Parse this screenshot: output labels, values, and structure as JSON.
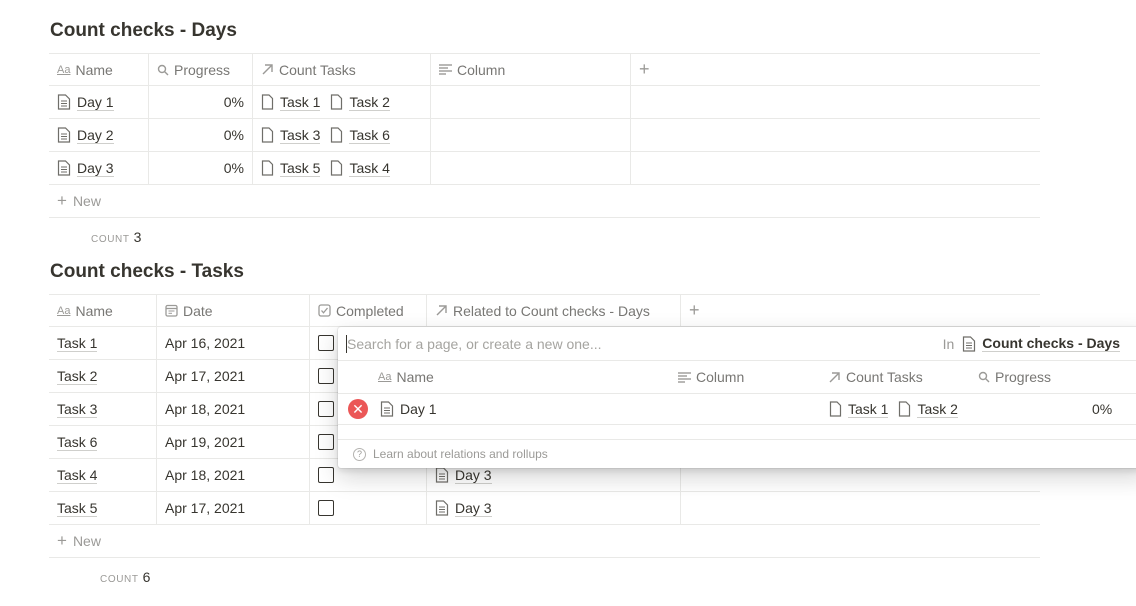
{
  "days_db": {
    "title": "Count checks - Days",
    "columns": {
      "name": "Name",
      "progress": "Progress",
      "count_tasks": "Count Tasks",
      "column": "Column"
    },
    "rows": [
      {
        "name": "Day 1",
        "progress": "0%",
        "task_a": "Task 1",
        "task_b": "Task 2"
      },
      {
        "name": "Day 2",
        "progress": "0%",
        "task_a": "Task 3",
        "task_b": "Task 6"
      },
      {
        "name": "Day 3",
        "progress": "0%",
        "task_a": "Task 5",
        "task_b": "Task 4"
      }
    ],
    "new_label": "New",
    "count_label": "COUNT",
    "count_value": "3"
  },
  "tasks_db": {
    "title": "Count checks - Tasks",
    "columns": {
      "name": "Name",
      "date": "Date",
      "completed": "Completed",
      "related": "Related to Count checks - Days"
    },
    "rows": [
      {
        "name": "Task 1",
        "date": "Apr 16, 2021",
        "related": ""
      },
      {
        "name": "Task 2",
        "date": "Apr 17, 2021",
        "related": ""
      },
      {
        "name": "Task 3",
        "date": "Apr 18, 2021",
        "related": ""
      },
      {
        "name": "Task 6",
        "date": "Apr 19, 2021",
        "related": ""
      },
      {
        "name": "Task 4",
        "date": "Apr 18, 2021",
        "related": "Day 3"
      },
      {
        "name": "Task 5",
        "date": "Apr 17, 2021",
        "related": "Day 3"
      }
    ],
    "new_label": "New",
    "count_label": "COUNT",
    "count_value": "6"
  },
  "popup": {
    "search_placeholder": "Search for a page, or create a new one...",
    "in_label": "In",
    "db_name": "Count checks - Days",
    "columns": {
      "name": "Name",
      "column": "Column",
      "count_tasks": "Count Tasks",
      "progress": "Progress"
    },
    "linked": {
      "name": "Day 1",
      "task_a": "Task 1",
      "task_b": "Task 2",
      "progress": "0%"
    },
    "footer": "Learn about relations and rollups"
  },
  "colors": {
    "text": "#37352f",
    "muted": "#9b9a97",
    "border": "#e9e9e7",
    "remove": "#eb5757"
  }
}
